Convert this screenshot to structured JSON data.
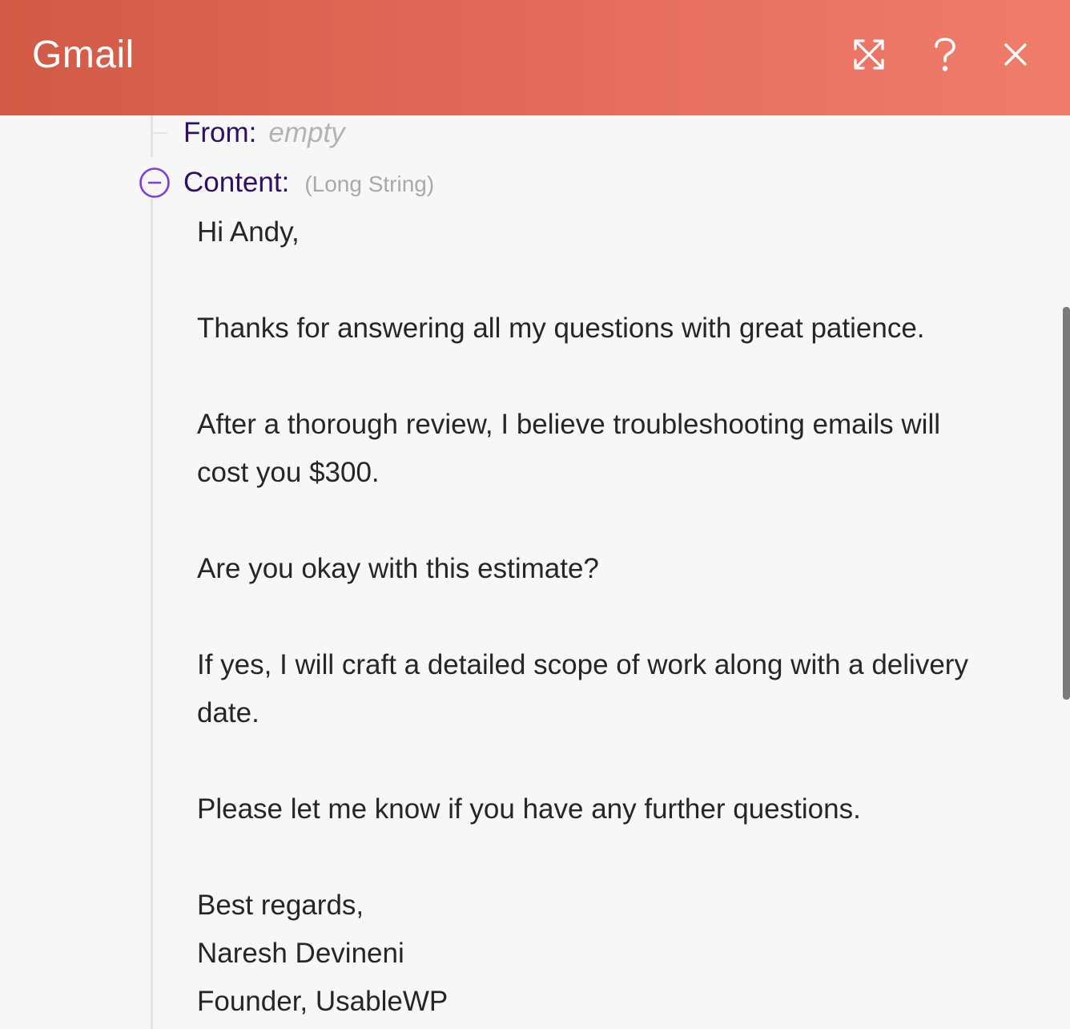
{
  "header": {
    "title": "Gmail",
    "expand_icon": "expand-arrows-icon",
    "help_icon": "question-mark-icon",
    "close_icon": "close-x-icon"
  },
  "fields": {
    "from": {
      "label": "From:",
      "value": "empty"
    },
    "content": {
      "label": "Content:",
      "type": "(Long String)",
      "toggle_icon": "minus-circle-icon"
    }
  },
  "email": {
    "lines": [
      "Hi Andy,",
      "",
      "Thanks for answering all my questions with great patience.",
      "",
      "After a thorough review, I believe troubleshooting emails will",
      "cost you $300.",
      "",
      "Are you okay with this estimate?",
      "",
      "If yes, I will craft a detailed scope of work along with a delivery",
      "date.",
      "",
      "Please let me know if you have any further questions.",
      "",
      "Best regards,",
      "Naresh Devineni",
      "Founder, UsableWP"
    ]
  },
  "colors": {
    "header_start": "#d15b45",
    "header_end": "#f07d6c",
    "label": "#2e1065",
    "toggle": "#7c3aed",
    "body_text": "#262626"
  }
}
